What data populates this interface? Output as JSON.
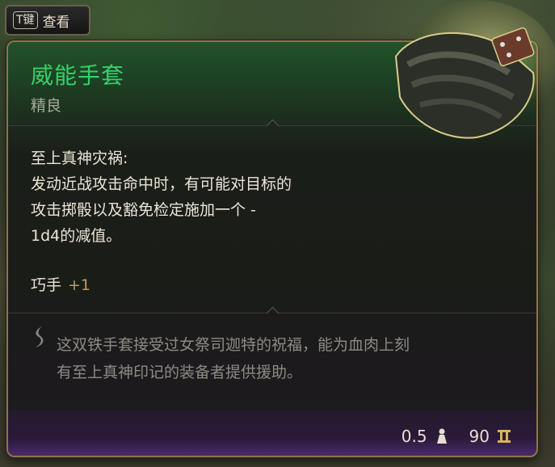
{
  "key_hint": {
    "key": "T键",
    "label": "查看"
  },
  "item": {
    "name": "威能手套",
    "rarity": "精良",
    "ability_title": "至上真神灾祸:",
    "ability_lines": [
      "发动近战攻击命中时，有可能对目标的",
      "攻击掷骰以及豁免检定施加一个 -",
      "1d4的减值。"
    ],
    "stat_label": "巧手",
    "stat_bonus": "+1",
    "lore_lines": [
      "这双铁手套接受过女祭司迦特的祝福，能为血肉上刻",
      "有至上真神印记的装备者提供援助。"
    ],
    "weight": "0.5",
    "value": "90"
  },
  "icons": [
    "weight-icon",
    "gold-icon",
    "lore-quill-icon",
    "gauntlet-item-image"
  ],
  "colors": {
    "name_green": "#37d06a",
    "border_gold": "#8a7550",
    "bonus": "#b89a6a"
  }
}
